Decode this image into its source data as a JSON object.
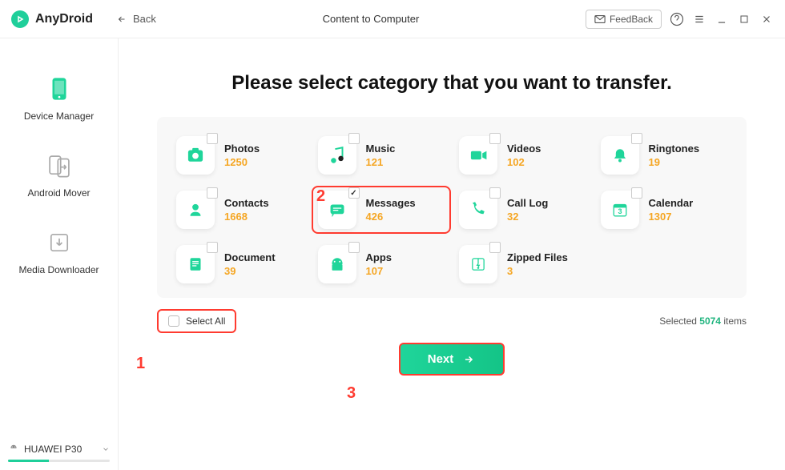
{
  "app": {
    "name": "AnyDroid"
  },
  "titlebar": {
    "back": "Back",
    "title": "Content to Computer",
    "feedback": "FeedBack"
  },
  "sidebar": {
    "items": [
      {
        "label": "Device Manager",
        "icon": "device-manager-icon"
      },
      {
        "label": "Android Mover",
        "icon": "android-mover-icon"
      },
      {
        "label": "Media Downloader",
        "icon": "media-downloader-icon"
      }
    ],
    "device": {
      "name": "HUAWEI P30"
    }
  },
  "main": {
    "heading": "Please select category that you want to transfer.",
    "categories": [
      {
        "label": "Photos",
        "count": "1250",
        "checked": false,
        "icon": "photos-icon"
      },
      {
        "label": "Music",
        "count": "121",
        "checked": false,
        "icon": "music-icon"
      },
      {
        "label": "Videos",
        "count": "102",
        "checked": false,
        "icon": "videos-icon"
      },
      {
        "label": "Ringtones",
        "count": "19",
        "checked": false,
        "icon": "ringtones-icon"
      },
      {
        "label": "Contacts",
        "count": "1668",
        "checked": false,
        "icon": "contacts-icon"
      },
      {
        "label": "Messages",
        "count": "426",
        "checked": true,
        "highlight": true,
        "icon": "messages-icon"
      },
      {
        "label": "Call Log",
        "count": "32",
        "checked": false,
        "icon": "call-log-icon"
      },
      {
        "label": "Calendar",
        "count": "1307",
        "checked": false,
        "icon": "calendar-icon"
      },
      {
        "label": "Document",
        "count": "39",
        "checked": false,
        "icon": "document-icon"
      },
      {
        "label": "Apps",
        "count": "107",
        "checked": false,
        "icon": "apps-icon"
      },
      {
        "label": "Zipped Files",
        "count": "3",
        "checked": false,
        "icon": "zipped-files-icon"
      }
    ],
    "select_all": "Select All",
    "selected_label_pre": "Selected ",
    "selected_count": "5074",
    "selected_label_post": " items",
    "next": "Next"
  },
  "annotations": {
    "a1": "1",
    "a2": "2",
    "a3": "3"
  },
  "colors": {
    "accent": "#1fcf9a",
    "count": "#f5a623",
    "highlight": "#ff3b30"
  }
}
